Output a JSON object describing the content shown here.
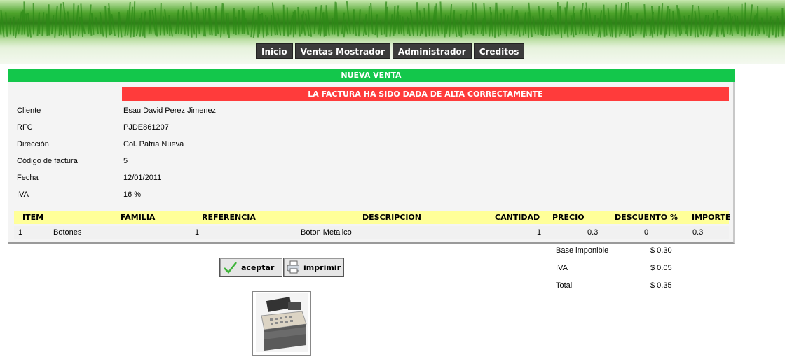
{
  "nav": {
    "items": [
      "Inicio",
      "Ventas Mostrador",
      "Administrador",
      "Creditos"
    ]
  },
  "title": "NUEVA VENTA",
  "alert": "LA FACTURA HA SIDO DADA DE ALTA CORRECTAMENTE",
  "fields": [
    {
      "label": "Cliente",
      "value": "Esau David Perez Jimenez"
    },
    {
      "label": "RFC",
      "value": "PJDE861207"
    },
    {
      "label": "Dirección",
      "value": "Col. Patria Nueva"
    },
    {
      "label": "Código de factura",
      "value": "5"
    },
    {
      "label": "Fecha",
      "value": "12/01/2011"
    },
    {
      "label": "IVA",
      "value": "16 %"
    }
  ],
  "table": {
    "headers": [
      "ITEM",
      "FAMILIA",
      "REFERENCIA",
      "DESCRIPCION",
      "CANTIDAD",
      "PRECIO",
      "DESCUENTO %",
      "IMPORTE"
    ],
    "rows": [
      [
        "1",
        "Botones",
        "1",
        "Boton Metalico",
        "1",
        "0.3",
        "0",
        "0.3"
      ]
    ]
  },
  "totals": [
    {
      "label": "Base imponible",
      "value": "$ 0.30"
    },
    {
      "label": "IVA",
      "value": "$ 0.05"
    },
    {
      "label": "Total",
      "value": "$ 0.35"
    }
  ],
  "buttons": {
    "accept": "aceptar",
    "print": "imprimir"
  },
  "colors": {
    "green": "#13c74b",
    "red": "#ff3b3b",
    "header_yellow": "#ffff99",
    "nav": "#3b3b3b"
  },
  "icons": {
    "accept": "check-icon",
    "print": "printer-icon",
    "register": "cash-register-icon"
  }
}
